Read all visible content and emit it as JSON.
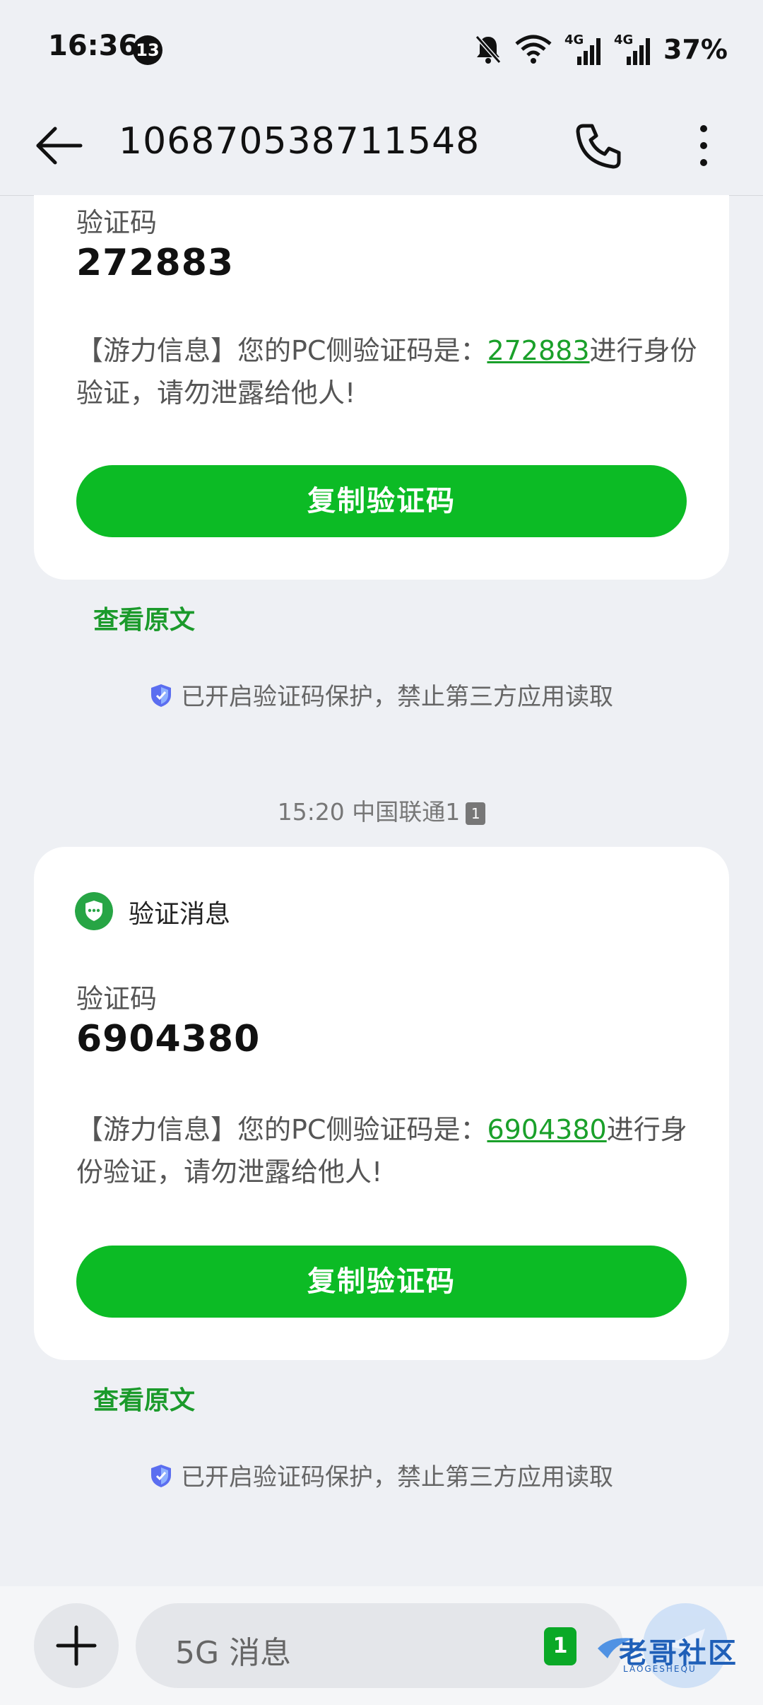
{
  "status_bar": {
    "time": "16:36",
    "notification_count": "13",
    "network_1": "4G",
    "network_2": "4G",
    "battery": "37%"
  },
  "header": {
    "contact_number": "106870538711548"
  },
  "messages": [
    {
      "code_label": "验证码",
      "code": "272883",
      "body_prefix": "【游力信息】您的PC侧验证码是：",
      "body_code": "272883",
      "body_suffix": "进行身份验证，请勿泄露给他人!",
      "copy_label": "复制验证码",
      "view_original": "查看原文",
      "protection_text": "已开启验证码保护，禁止第三方应用读取"
    },
    {
      "timestamp": "15:20 中国联通1",
      "sim_slot": "1",
      "header_title": "验证消息",
      "code_label": "验证码",
      "code": "6904380",
      "body_prefix": "【游力信息】您的PC侧验证码是：",
      "body_code": "6904380",
      "body_suffix": "进行身份验证，请勿泄露给他人!",
      "copy_label": "复制验证码",
      "view_original": "查看原文",
      "protection_text": "已开启验证码保护，禁止第三方应用读取"
    }
  ],
  "composer": {
    "placeholder": "5G 消息",
    "sim_indicator": "1"
  },
  "watermark": {
    "text": "老哥社区",
    "sub": "LAOGESHEQU"
  },
  "colors": {
    "accent_green": "#0cbb25",
    "link_green": "#1aa02a",
    "background": "#eef0f4"
  },
  "icons": [
    "back-arrow-icon",
    "phone-icon",
    "more-vert-icon",
    "bell-off-icon",
    "wifi-icon",
    "signal-icon",
    "shield-check-icon",
    "chat-shield-icon",
    "plus-icon",
    "send-icon"
  ]
}
